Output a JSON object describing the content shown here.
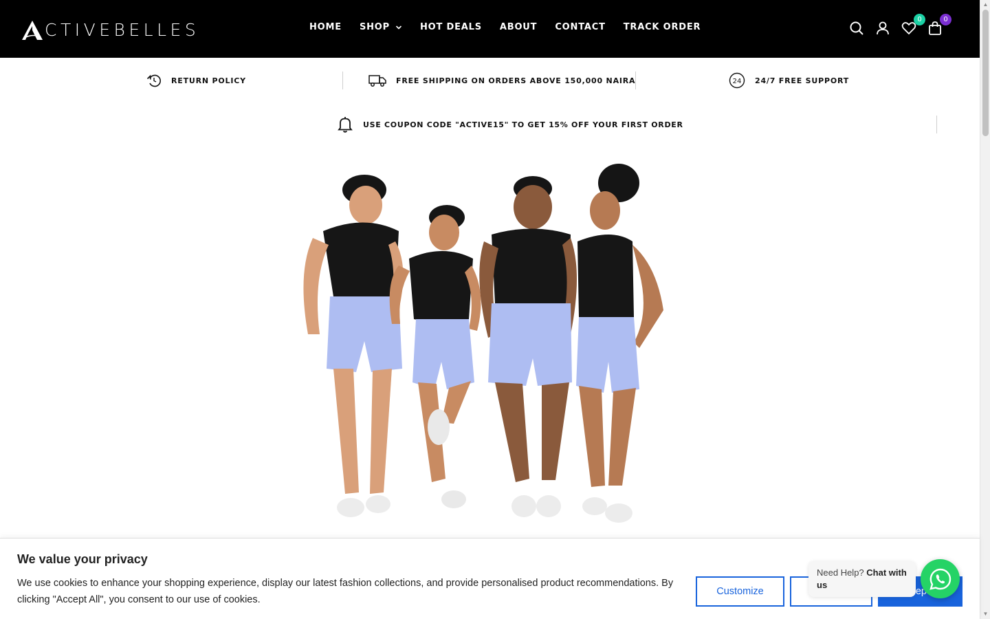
{
  "brand": {
    "logo_text": "CTIVEBELLES",
    "logo_icon": "triangle-a-logo-icon"
  },
  "nav": {
    "items": [
      {
        "label": "HOME"
      },
      {
        "label": "SHOP",
        "has_dropdown": true
      },
      {
        "label": "HOT DEALS"
      },
      {
        "label": "ABOUT"
      },
      {
        "label": "CONTACT"
      },
      {
        "label": "TRACK ORDER"
      }
    ]
  },
  "header_icons": {
    "search": "search-icon",
    "account": "user-icon",
    "wishlist": {
      "icon": "heart-icon",
      "count": "0",
      "badge_color": "#1bd1a5"
    },
    "cart": {
      "icon": "cart-icon",
      "count": "0",
      "badge_color": "#7b2fd1"
    }
  },
  "info_strip": {
    "return_policy": "RETURN POLICY",
    "shipping": "FREE SHIPPING ON ORDERS ABOVE 150,000 NAIRA",
    "support": "24/7 FREE SUPPORT",
    "support_icon_text": "24"
  },
  "coupon": {
    "text": "USE COUPON CODE \"ACTIVE15\" TO GET 15% OFF YOUR FIRST ORDER"
  },
  "cookie": {
    "title": "We value your privacy",
    "body": "We use cookies to enhance your shopping experience, display our latest fashion collections, and provide personalised product recommendations. By clicking \"Accept All\", you consent to our use of cookies.",
    "customize": "Customize",
    "accept_partial": "ep"
  },
  "whatsapp": {
    "prefix": "Need Help?",
    "emph": "Chat with us"
  },
  "colors": {
    "header_bg": "#000000",
    "accent_blue": "#1863dc",
    "whatsapp_green": "#25d366"
  }
}
